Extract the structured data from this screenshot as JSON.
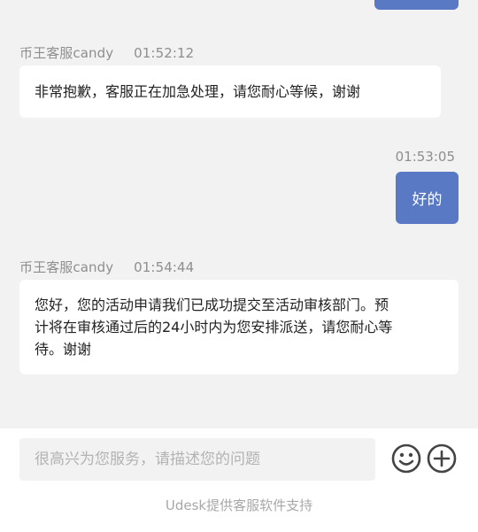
{
  "messages": [
    {
      "sender": "币王客服candy",
      "time": "01:52:12",
      "text": "非常抱歉，客服正在加急处理，请您耐心等候，谢谢"
    },
    {
      "time": "01:53:05",
      "text": "好的"
    },
    {
      "sender": "币王客服candy",
      "time": "01:54:44",
      "lines": [
        "您好，您的活动申请我们已成功提交至活动审核部门。预",
        "计将在审核通过后的24小时内为您安排派送，请您耐心等",
        "待。谢谢"
      ]
    }
  ],
  "composer": {
    "placeholder": "很高兴为您服务，请描述您的问题",
    "emoji_icon": "smiley-face-icon",
    "add_icon": "plus-circle-icon"
  },
  "footer": {
    "powered_by": "Udesk提供客服软件支持"
  },
  "colors": {
    "outgoing_bubble": "#5a79c5",
    "background": "#f2f2f2"
  }
}
